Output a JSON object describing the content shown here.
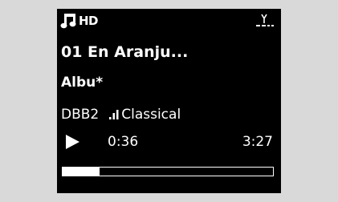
{
  "device": {
    "source_icon": "music-note-icon",
    "source_label": "HD",
    "signal_icon": "antenna-icon"
  },
  "track": {
    "title": "01 En Aranju...",
    "album": "Albu*",
    "station": "DBB2",
    "genre_icon": "equalizer-icon",
    "genre": "Classical"
  },
  "playback": {
    "state_icon": "play-icon",
    "elapsed": "0:36",
    "total": "3:27",
    "progress_fraction": 0.174
  },
  "colors": {
    "screen_bg": "#000000",
    "screen_fg": "#ffffff",
    "frame_bg": "#d9d9d9"
  }
}
